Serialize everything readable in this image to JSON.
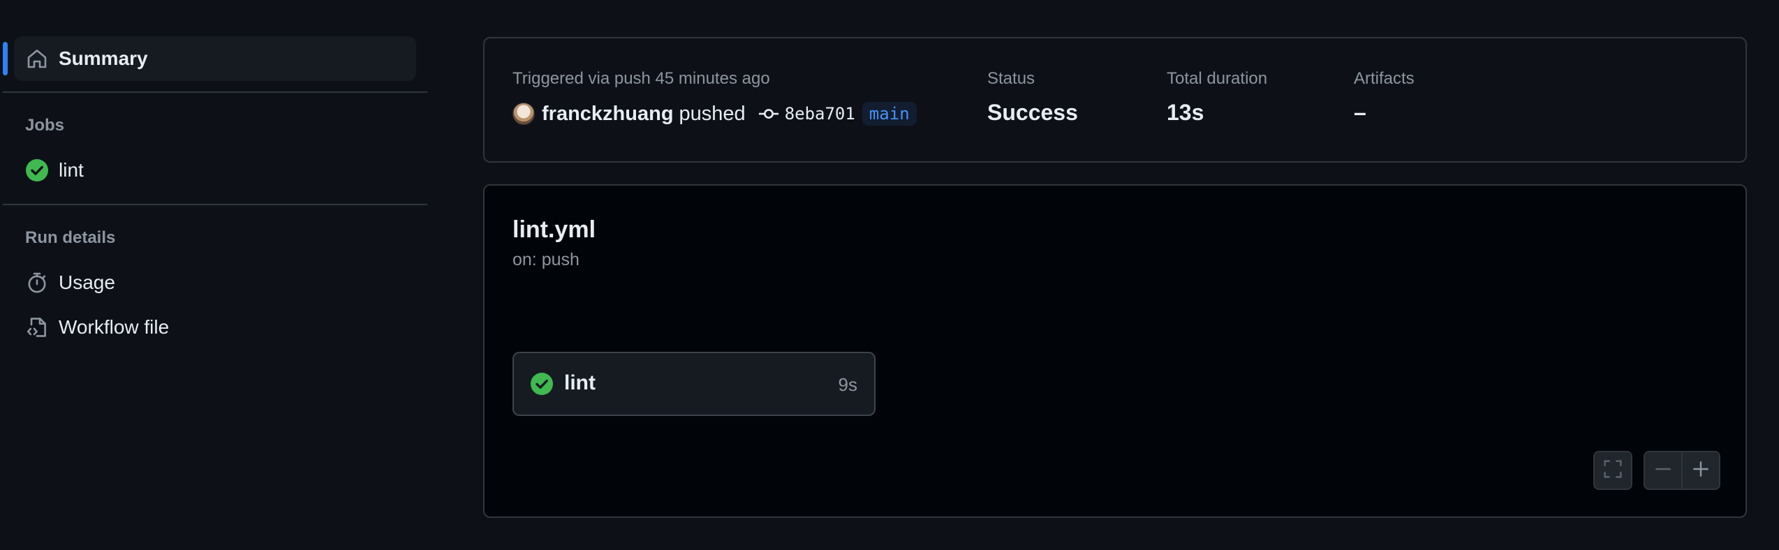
{
  "sidebar": {
    "summary_label": "Summary",
    "jobs_heading": "Jobs",
    "jobs": [
      {
        "label": "lint",
        "status": "success"
      }
    ],
    "run_details_heading": "Run details",
    "usage_label": "Usage",
    "workflow_file_label": "Workflow file"
  },
  "run_summary": {
    "trigger_text": "Triggered via push 45 minutes ago",
    "actor": "franckzhuang",
    "action": "pushed",
    "commit_sha": "8eba701",
    "branch": "main",
    "status_label": "Status",
    "status_value": "Success",
    "duration_label": "Total duration",
    "duration_value": "13s",
    "artifacts_label": "Artifacts",
    "artifacts_value": "–"
  },
  "workflow": {
    "file_name": "lint.yml",
    "trigger": "on: push",
    "jobs": [
      {
        "name": "lint",
        "duration": "9s",
        "status": "success"
      }
    ]
  },
  "colors": {
    "background": "#0d1117",
    "accent": "#2f81f7",
    "success": "#3fb950",
    "muted_text": "#8d96a0",
    "branch_text": "#4493f8"
  },
  "icons": {
    "summary": "home-icon",
    "job_status": "check-circle-icon",
    "usage": "stopwatch-icon",
    "workflow_file": "file-code-icon",
    "commit": "git-commit-icon",
    "fullscreen": "fullscreen-icon",
    "zoom_out": "minus-icon",
    "zoom_in": "plus-icon"
  }
}
